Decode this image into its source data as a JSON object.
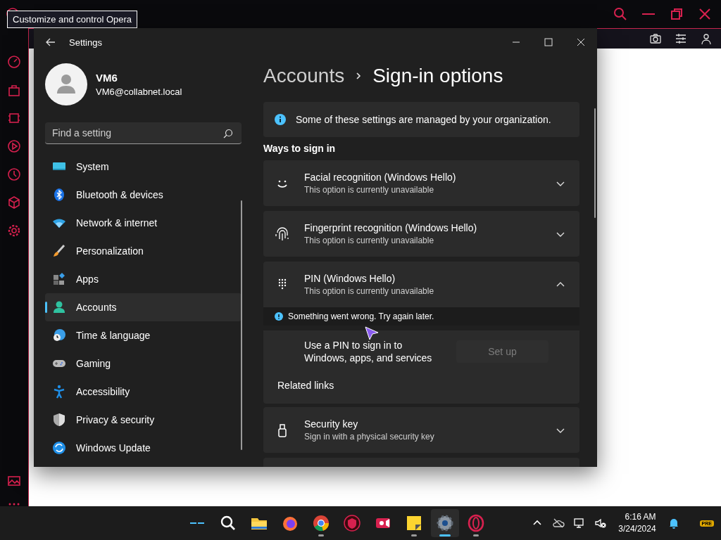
{
  "browser": {
    "tooltip": "Customize and control Opera"
  },
  "settings": {
    "title": "Settings",
    "user": {
      "name": "VM6",
      "email": "VM6@collabnet.local"
    },
    "search": {
      "placeholder": "Find a setting"
    },
    "nav": [
      {
        "kind": "system",
        "label": "System",
        "selected": false
      },
      {
        "kind": "bluetooth",
        "label": "Bluetooth & devices",
        "selected": false
      },
      {
        "kind": "network",
        "label": "Network & internet",
        "selected": false
      },
      {
        "kind": "personalization",
        "label": "Personalization",
        "selected": false
      },
      {
        "kind": "apps",
        "label": "Apps",
        "selected": false
      },
      {
        "kind": "accounts",
        "label": "Accounts",
        "selected": true
      },
      {
        "kind": "time",
        "label": "Time & language",
        "selected": false
      },
      {
        "kind": "gaming",
        "label": "Gaming",
        "selected": false
      },
      {
        "kind": "accessibility",
        "label": "Accessibility",
        "selected": false
      },
      {
        "kind": "privacy",
        "label": "Privacy & security",
        "selected": false
      },
      {
        "kind": "update",
        "label": "Windows Update",
        "selected": false
      }
    ],
    "breadcrumb": {
      "parent": "Accounts",
      "current": "Sign-in options"
    },
    "notice": "Some of these settings are managed by your organization.",
    "section": "Ways to sign in",
    "options": [
      {
        "kind": "face",
        "title": "Facial recognition (Windows Hello)",
        "subtitle": "This option is currently unavailable",
        "expanded": false
      },
      {
        "kind": "fingerprint",
        "title": "Fingerprint recognition (Windows Hello)",
        "subtitle": "This option is currently unavailable",
        "expanded": false
      },
      {
        "kind": "pin",
        "title": "PIN (Windows Hello)",
        "subtitle": "This option is currently unavailable",
        "expanded": true,
        "error": "Something went wrong. Try again later.",
        "detail": "Use a PIN to sign in to Windows, apps, and services",
        "button": {
          "label": "Set up",
          "disabled": true
        },
        "related": "Related links"
      },
      {
        "kind": "key",
        "title": "Security key",
        "subtitle": "Sign in with a physical security key",
        "expanded": false
      }
    ]
  },
  "taskbar": {
    "apps": [
      {
        "kind": "widgets",
        "running": false,
        "selected": false
      },
      {
        "kind": "search",
        "running": false,
        "selected": false
      },
      {
        "kind": "explorer",
        "running": false,
        "selected": false
      },
      {
        "kind": "firefox",
        "running": false,
        "selected": false
      },
      {
        "kind": "chrome",
        "running": true,
        "selected": false
      },
      {
        "kind": "shield",
        "running": false,
        "selected": false
      },
      {
        "kind": "recorder",
        "running": false,
        "selected": false
      },
      {
        "kind": "notes",
        "running": true,
        "selected": false
      },
      {
        "kind": "settings",
        "running": true,
        "selected": true
      },
      {
        "kind": "opera",
        "running": true,
        "selected": false
      }
    ],
    "time": "6:16 AM",
    "date": "3/24/2024",
    "badge": "PRE"
  }
}
